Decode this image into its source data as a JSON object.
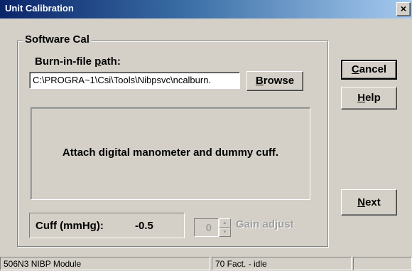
{
  "window": {
    "title": "Unit Calibration",
    "close_label": "×"
  },
  "group": {
    "title": "Software Cal",
    "path_label_pre": "Burn-in-file ",
    "path_label_acc": "p",
    "path_label_post": "ath:",
    "path_value": "C:\\PROGRA~1\\Csi\\Tools\\Nibpsvc\\ncalburn.",
    "browse_acc": "B",
    "browse_rest": "rowse",
    "message": "Attach digital manometer and dummy cuff.",
    "cuff_label": "Cuff (mmHg):",
    "cuff_value": "-0.5",
    "gain_value": "0",
    "gain_label": "Gain adjust"
  },
  "buttons": {
    "cancel_acc": "C",
    "cancel_rest": "ancel",
    "help_acc": "H",
    "help_rest": "elp",
    "next_acc": "N",
    "next_rest": "ext"
  },
  "status": {
    "pane1": "506N3 NIBP Module",
    "pane2": "70 Fact. - idle",
    "pane3": ""
  }
}
